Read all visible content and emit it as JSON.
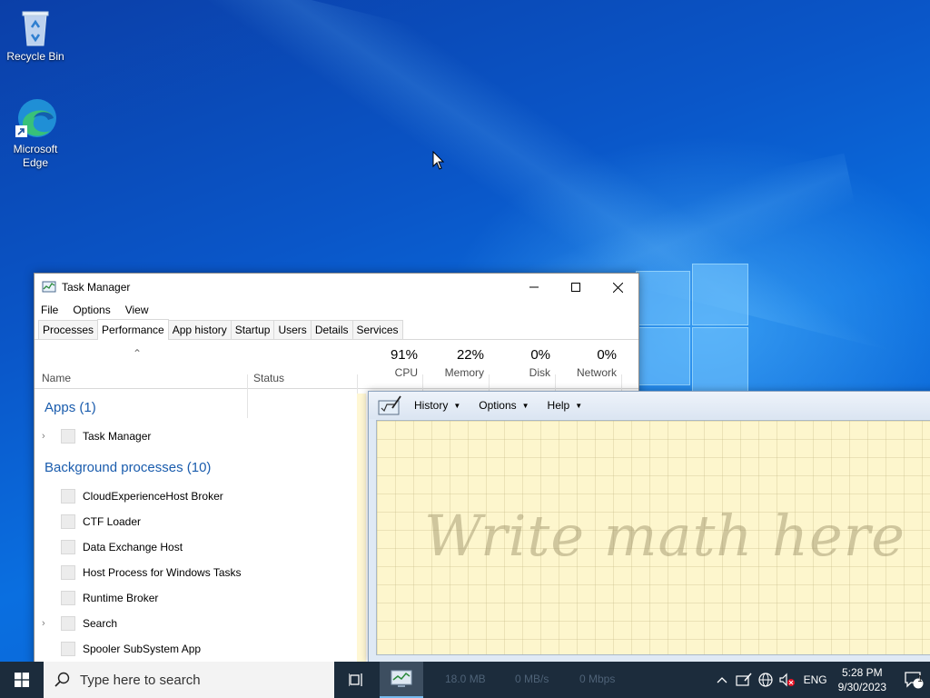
{
  "desktop": {
    "icons": [
      {
        "label": "Recycle Bin",
        "icon": "recycle-bin-icon"
      },
      {
        "label": "Microsoft Edge",
        "icon": "edge-icon"
      }
    ]
  },
  "task_manager": {
    "title": "Task Manager",
    "menu": [
      "File",
      "Options",
      "View"
    ],
    "tabs": [
      "Processes",
      "Performance",
      "App history",
      "Startup",
      "Users",
      "Details",
      "Services"
    ],
    "active_tab": "Performance",
    "columns": {
      "name": "Name",
      "status": "Status",
      "cpu": {
        "value": "91%",
        "label": "CPU"
      },
      "memory": {
        "value": "22%",
        "label": "Memory"
      },
      "disk": {
        "value": "0%",
        "label": "Disk"
      },
      "network": {
        "value": "0%",
        "label": "Network"
      }
    },
    "groups": {
      "apps": "Apps (1)",
      "background": "Background processes (10)"
    },
    "apps": [
      {
        "name": "Task Manager",
        "expandable": true
      }
    ],
    "background": [
      {
        "name": "CloudExperienceHost Broker",
        "expandable": false
      },
      {
        "name": "CTF Loader",
        "expandable": false
      },
      {
        "name": "Data Exchange Host",
        "expandable": false
      },
      {
        "name": "Host Process for Windows Tasks",
        "expandable": false
      },
      {
        "name": "Runtime Broker",
        "expandable": false
      },
      {
        "name": "Search",
        "expandable": true
      },
      {
        "name": "Spooler SubSystem App",
        "expandable": false
      }
    ]
  },
  "math_panel": {
    "menu": [
      "History",
      "Options",
      "Help"
    ],
    "hint": "Write math here"
  },
  "taskbar": {
    "search_placeholder": "Type here to search",
    "ghost_memory": "18.0 MB",
    "ghost_disk": "0 MB/s",
    "ghost_network": "0 Mbps",
    "language": "ENG",
    "time": "5:28 PM",
    "date": "9/30/2023",
    "notification_count": "1"
  },
  "colors": {
    "accent": "#1a5cad",
    "taskbar": "#1c2c3c",
    "math_canvas": "#fdf6cd"
  }
}
